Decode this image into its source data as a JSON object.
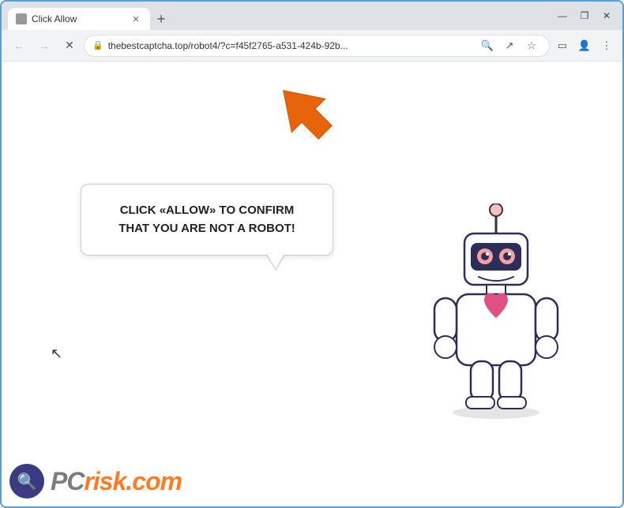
{
  "browser": {
    "tab": {
      "label": "Click Allow",
      "favicon_alt": "page-favicon"
    },
    "new_tab_label": "+",
    "window_controls": {
      "minimize": "—",
      "maximize": "❐",
      "close": "✕"
    },
    "address_bar": {
      "url": "thebestcaptcha.top/robot4/?c=f45f2765-a531-424b-92b...",
      "lock_icon": "🔒"
    },
    "nav": {
      "back": "←",
      "forward": "→",
      "reload": "✕"
    }
  },
  "page": {
    "speech_bubble_text": "CLICK «ALLOW» TO CONFIRM THAT YOU ARE NOT A ROBOT!",
    "arrow_direction": "upper-left",
    "cursor_symbol": "↖"
  },
  "watermark": {
    "brand": "PC",
    "brand_suffix": "risk.com"
  }
}
